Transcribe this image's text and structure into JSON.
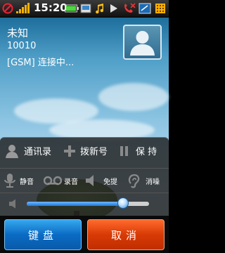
{
  "status_bar": {
    "time": "15:20",
    "icons": [
      "no-sim-icon",
      "signal-icon",
      "battery-icon",
      "sms-icon",
      "music-icon",
      "play-icon",
      "missed-call-icon",
      "memory-card-icon",
      "grid-icon"
    ]
  },
  "call": {
    "caller_name": "未知",
    "caller_number": "10010",
    "status": "[GSM]  连接中..."
  },
  "controls": {
    "contacts_label": "通讯录",
    "add_call_label": "拨新号",
    "hold_label": "保 持",
    "mute_label": "静音",
    "record_label": "录音",
    "speaker_label": "免提",
    "noise_label": "消噪",
    "volume_level": 0.79
  },
  "buttons": {
    "keypad_label": "键盘",
    "cancel_label": "取消"
  },
  "colors": {
    "keypad": "#0a6bc4",
    "cancel": "#d83a06",
    "slider": "#1f78d9"
  }
}
